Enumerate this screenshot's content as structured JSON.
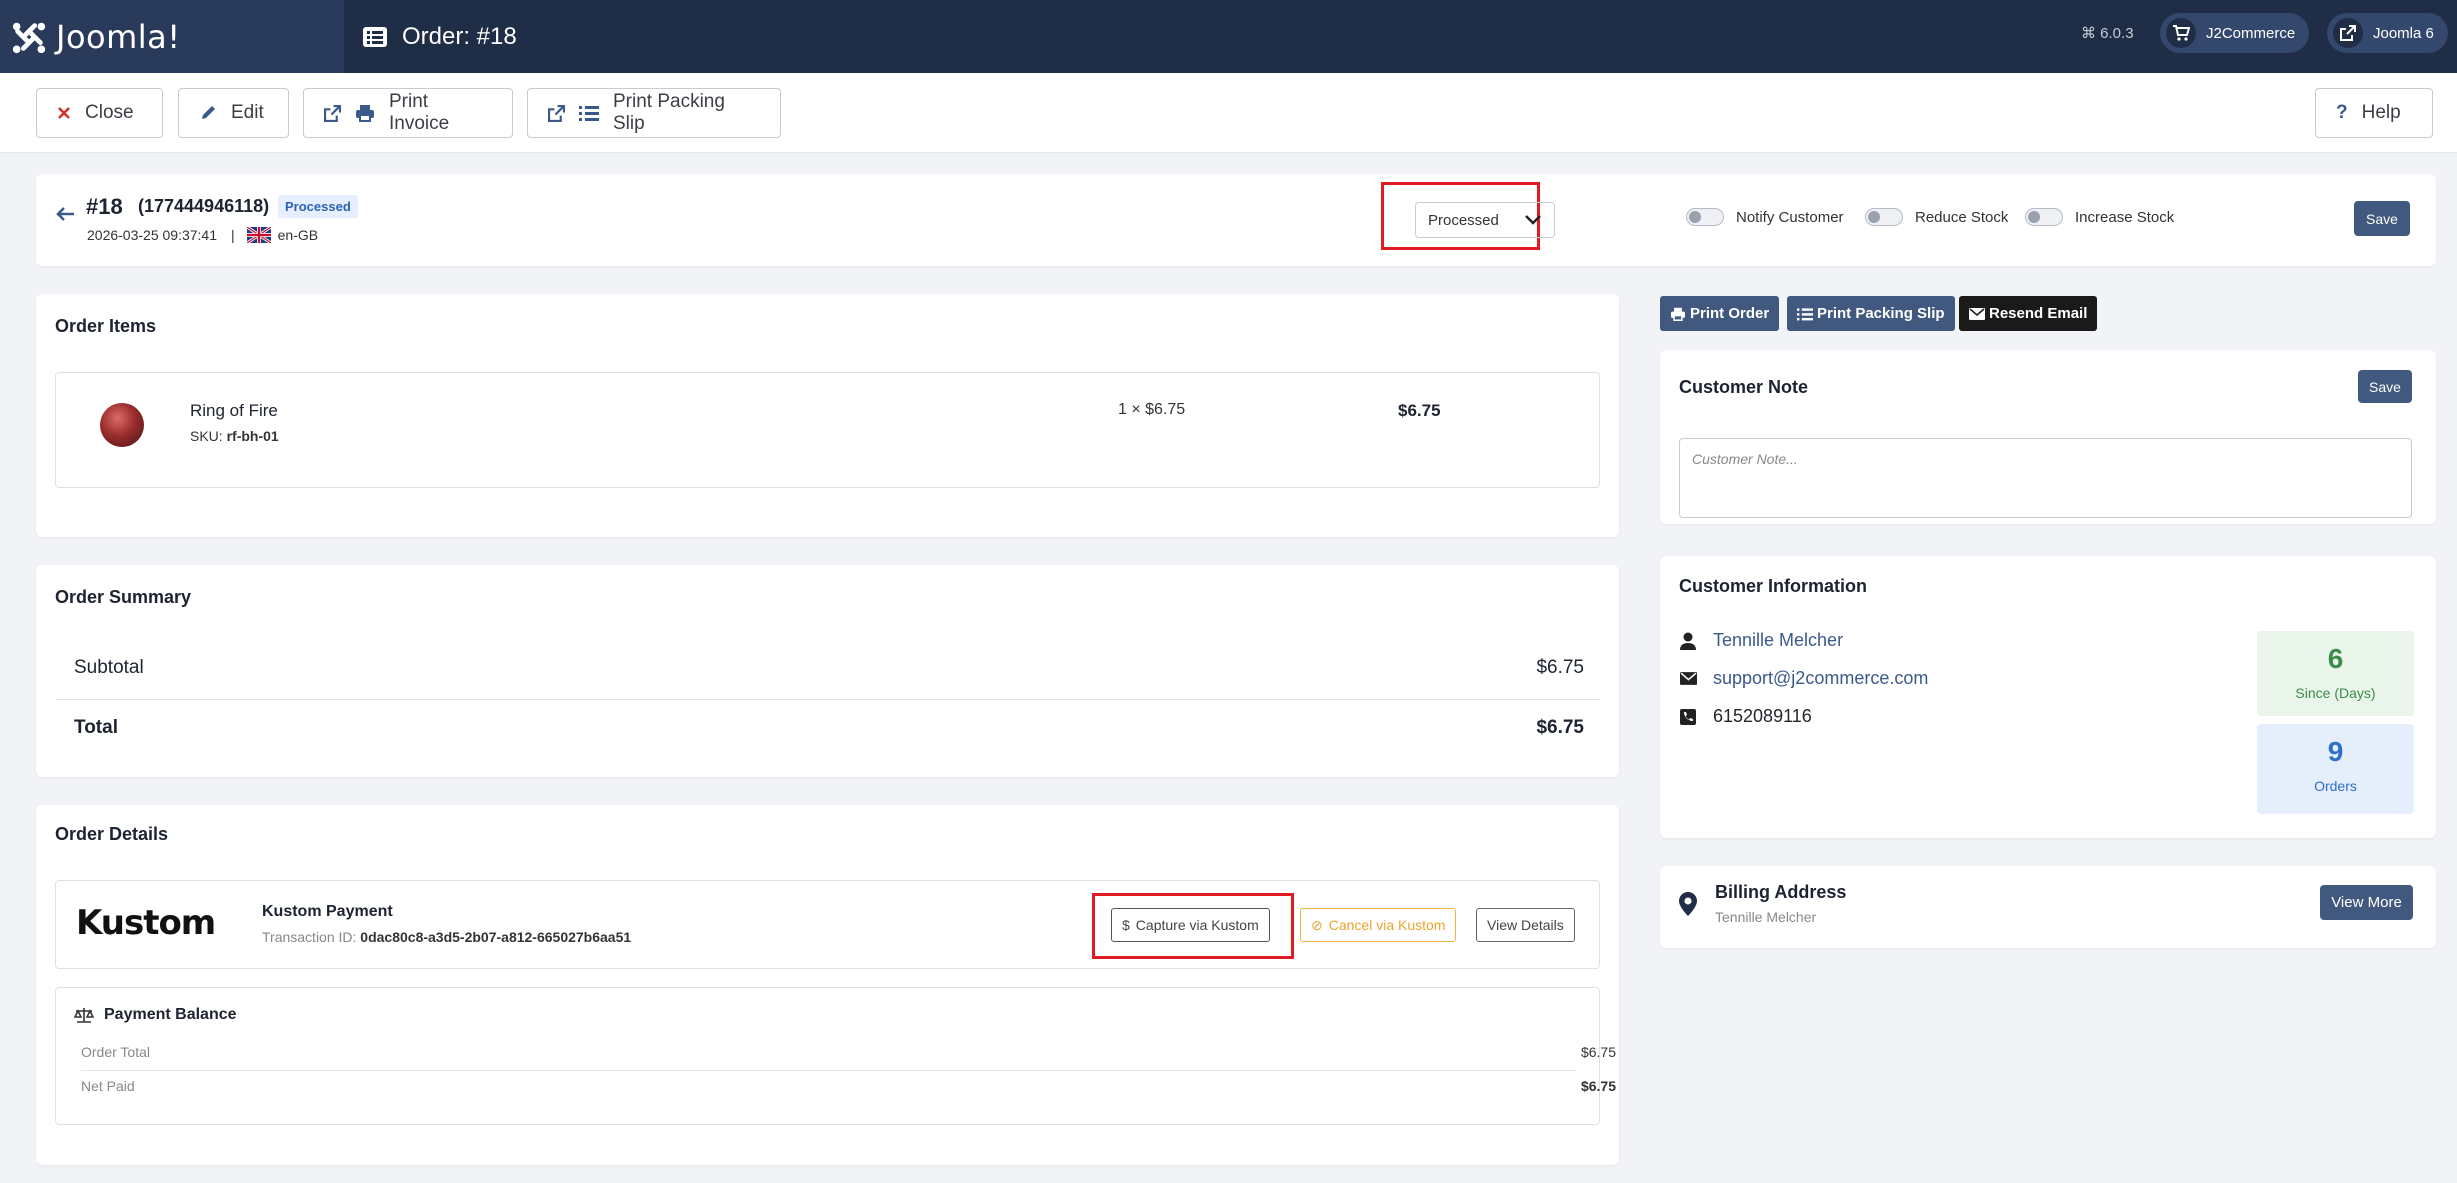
{
  "header": {
    "brand": "Joomla!",
    "title": "Order: #18",
    "version": "6.0.3",
    "store_button": "J2Commerce",
    "site_button": "Joomla 6"
  },
  "toolbar": {
    "close": "Close",
    "edit": "Edit",
    "print_invoice": "Print Invoice",
    "print_packing_slip": "Print Packing Slip",
    "help": "Help"
  },
  "order": {
    "number": "#18",
    "reference": "(177444946118)",
    "status_badge": "Processed",
    "date": "2026-03-25 09:37:41",
    "separator": "|",
    "language": "en-GB",
    "notify_customer": "Notify Customer",
    "reduce_stock": "Reduce Stock",
    "increase_stock": "Increase Stock",
    "status_selected": "Processed",
    "save": "Save"
  },
  "items": {
    "title": "Order Items",
    "rows": [
      {
        "name": "Ring of Fire",
        "sku_label": "SKU:",
        "sku": "rf-bh-01",
        "qty_price": "1 × $6.75",
        "total": "$6.75"
      }
    ]
  },
  "summary": {
    "title": "Order Summary",
    "subtotal_label": "Subtotal",
    "subtotal_value": "$6.75",
    "total_label": "Total",
    "total_value": "$6.75"
  },
  "details": {
    "title": "Order Details",
    "payment_logo": "Kustom",
    "payment_name": "Kustom Payment",
    "tx_label": "Transaction ID:",
    "tx_id": "0dac80c8-a3d5-2b07-a812-665027b6aa51",
    "capture": "Capture via Kustom",
    "cancel": "Cancel via Kustom",
    "view_details": "View Details",
    "balance_title": "Payment Balance",
    "order_total_label": "Order Total",
    "order_total_value": "$6.75",
    "net_paid_label": "Net Paid",
    "net_paid_value": "$6.75"
  },
  "actions": {
    "print_order": "Print Order",
    "print_packing_slip": "Print Packing Slip",
    "resend_email": "Resend Email"
  },
  "note": {
    "title": "Customer Note",
    "save": "Save",
    "placeholder": "Customer Note..."
  },
  "customer": {
    "title": "Customer Information",
    "name": "Tennille Melcher",
    "email": "support@j2commerce.com",
    "phone": "6152089116",
    "since_value": "6",
    "since_label": "Since (Days)",
    "orders_value": "9",
    "orders_label": "Orders"
  },
  "billing": {
    "title": "Billing Address",
    "name": "Tennille Melcher",
    "view_more": "View More"
  },
  "colors": {
    "topbar": "#1f2d46",
    "primary_button": "#41597f",
    "highlight": "#e01b24",
    "link": "#3a5a8c",
    "since_green": "#3d8c4a",
    "orders_blue": "#2f6fc7"
  }
}
